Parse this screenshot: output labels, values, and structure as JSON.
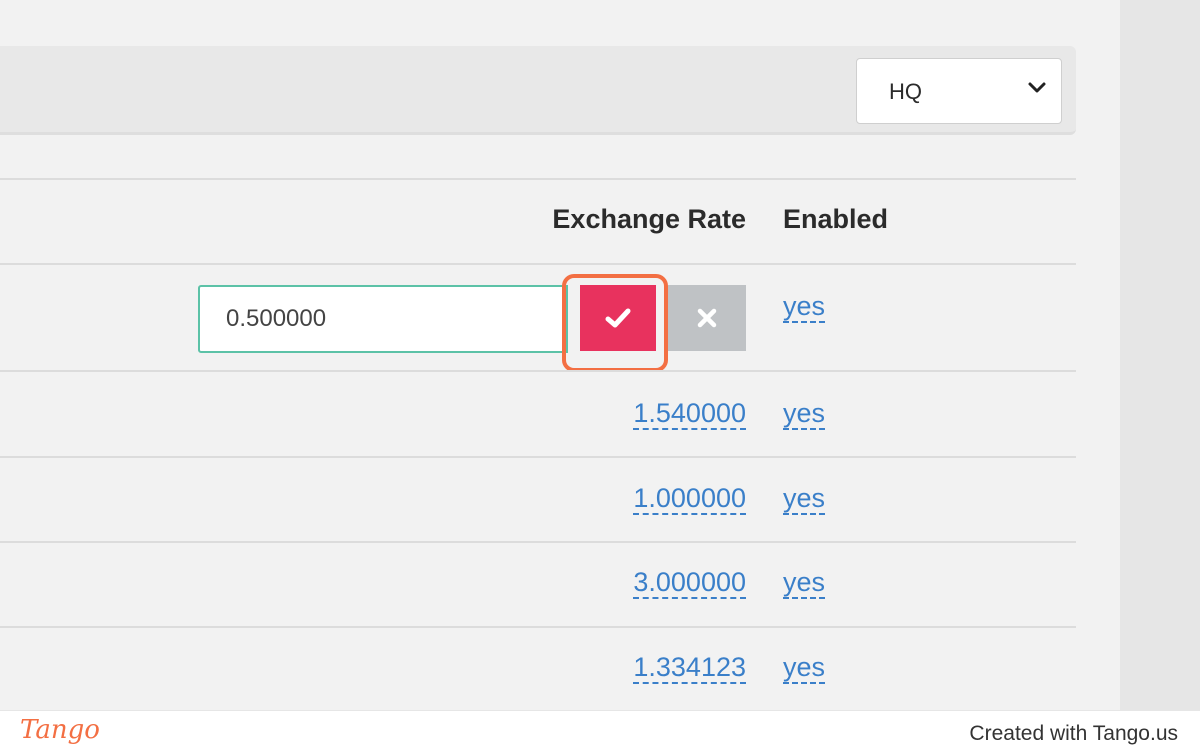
{
  "toolbar": {
    "location_select": {
      "selected": "HQ"
    }
  },
  "table": {
    "columns": {
      "exchange_rate": "Exchange Rate",
      "enabled": "Enabled"
    },
    "editing_row": {
      "rate_input_value": "0.500000",
      "enabled": "yes"
    },
    "rows": [
      {
        "exchange_rate": "1.540000",
        "enabled": "yes"
      },
      {
        "exchange_rate": "1.000000",
        "enabled": "yes"
      },
      {
        "exchange_rate": "3.000000",
        "enabled": "yes"
      },
      {
        "exchange_rate": "1.334123",
        "enabled": "yes"
      }
    ]
  },
  "icons": {
    "confirm": "check-icon",
    "cancel": "close-icon",
    "select": "chevron-down-icon"
  },
  "colors": {
    "confirm_button": "#e8325e",
    "cancel_button": "#bfc2c5",
    "link": "#3a7fc9",
    "input_border": "#5cc2a7",
    "highlight": "#f36f43"
  },
  "footer": {
    "logo": "Tango",
    "credit": "Created with Tango.us"
  }
}
